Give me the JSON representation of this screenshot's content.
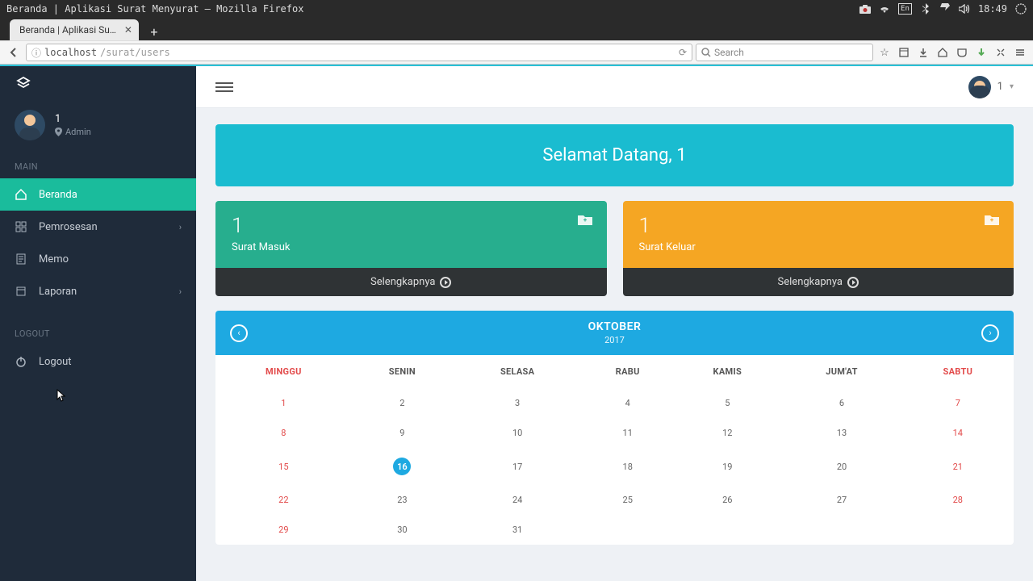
{
  "os": {
    "title": "Beranda | Aplikasi Surat Menyurat – Mozilla Firefox",
    "time": "18:49",
    "lang": "En"
  },
  "browser": {
    "tab_title": "Beranda | Aplikasi Su…",
    "url_host": "localhost",
    "url_path": "/surat/users",
    "search_placeholder": "Search"
  },
  "sidebar": {
    "user": {
      "name": "1",
      "role": "Admin"
    },
    "sections": {
      "main": "MAIN",
      "logout": "LOGOUT"
    },
    "items": {
      "beranda": "Beranda",
      "pemrosesan": "Pemrosesan",
      "memo": "Memo",
      "laporan": "Laporan",
      "logout": "Logout"
    }
  },
  "topbar": {
    "user_label": "1"
  },
  "banner": {
    "text": "Selamat Datang, 1"
  },
  "cards": {
    "inbox": {
      "count": "1",
      "label": "Surat Masuk",
      "more": "Selengkapnya"
    },
    "outbox": {
      "count": "1",
      "label": "Surat Keluar",
      "more": "Selengkapnya"
    }
  },
  "calendar": {
    "month": "OKTOBER",
    "year": "2017",
    "today": 16,
    "days": [
      "MINGGU",
      "SENIN",
      "SELASA",
      "RABU",
      "KAMIS",
      "JUM'AT",
      "SABTU"
    ],
    "weeks": [
      [
        1,
        2,
        3,
        4,
        5,
        6,
        7
      ],
      [
        8,
        9,
        10,
        11,
        12,
        13,
        14
      ],
      [
        15,
        16,
        17,
        18,
        19,
        20,
        21
      ],
      [
        22,
        23,
        24,
        25,
        26,
        27,
        28
      ],
      [
        29,
        30,
        31,
        null,
        null,
        null,
        null
      ]
    ]
  },
  "colors": {
    "teal": "#1abcd0",
    "green": "#27ae8e",
    "orange": "#f5a623",
    "blue": "#1ea9e1",
    "sidebar": "#1f2b3a"
  }
}
